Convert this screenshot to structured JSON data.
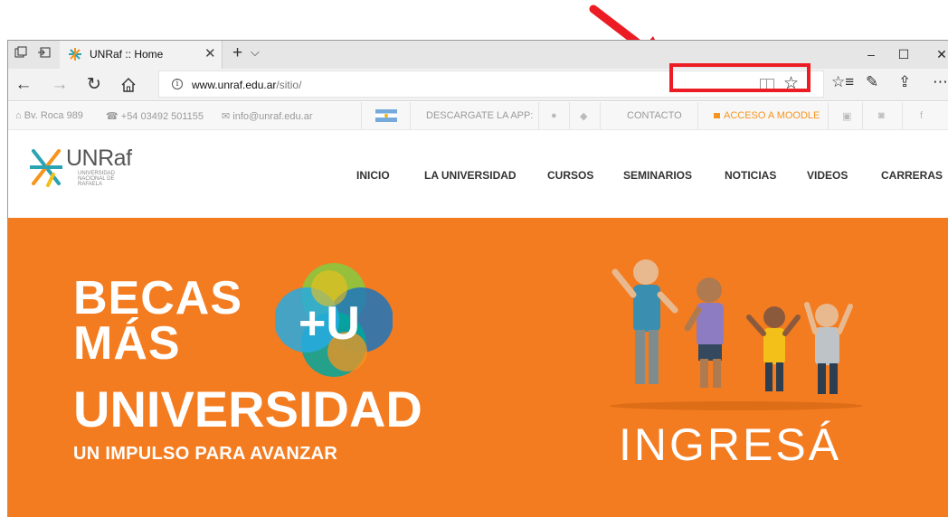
{
  "browser": {
    "tab_title": "UNRaf :: Home",
    "url_host": "www.unraf.edu.ar",
    "url_path": "/sitio/"
  },
  "top_strip": {
    "address": "Bv. Roca 989",
    "phone": "+54 03492 501155",
    "email": "info@unraf.edu.ar",
    "app_label": "DESCARGATE LA APP:",
    "contact": "CONTACTO",
    "moodle": "ACCESO A MOODLE"
  },
  "logo": {
    "name": "UNRaf",
    "subtitle": "UNIVERSIDAD NACIONAL DE RAFAELA"
  },
  "nav": {
    "items": [
      "INICIO",
      "LA UNIVERSIDAD",
      "CURSOS",
      "SEMINARIOS",
      "NOTICIAS",
      "VIDEOS",
      "CARRERAS"
    ]
  },
  "hero": {
    "line1": "BECAS",
    "line2": "MÁS",
    "line3": "UNIVERSIDAD",
    "tagline": "UN IMPULSO PARA AVANZAR",
    "badge": "+U",
    "cta": "INGRESÁ",
    "background": "#f47c20"
  },
  "annotation": {
    "color": "#ec1c24"
  }
}
